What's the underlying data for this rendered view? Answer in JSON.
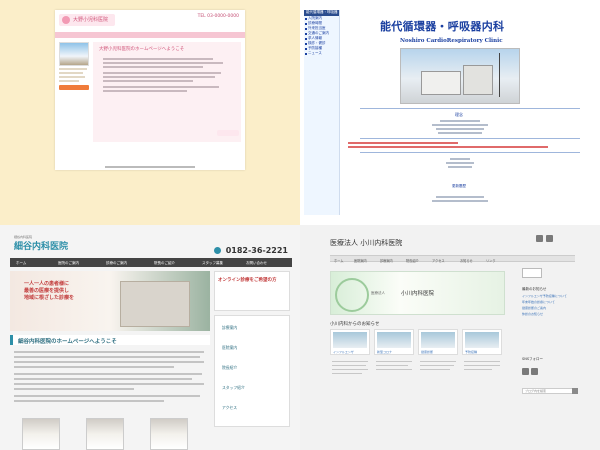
{
  "panel1": {
    "logo": "大野小児科医院",
    "tel": "TEL 03-0000-0000",
    "welcome": "大野小児科医院のホームページへようこそ"
  },
  "panel2": {
    "nav_top": "能代循環器・呼吸器",
    "nav_items": [
      "入院案内",
      "診療時間",
      "外来担当医",
      "交通のご案内",
      "求人情報",
      "検診・健診",
      "予防接種",
      "ニュース"
    ],
    "title": "能代循環器・呼吸器内科",
    "subtitle": "Noshiro CardioRespiratory Clinic",
    "rinen": "理念",
    "link": "更新履歴"
  },
  "panel3": {
    "logo_sub": "細谷内科医院",
    "logo": "細谷内科医院",
    "phone": "0182-36-2221",
    "nav": [
      "ホーム",
      "医院のご案内",
      "診療のご案内",
      "院長のご紹介",
      "スタッフ募集",
      "お問い合わせ"
    ],
    "hero_lines": [
      "一人一人の患者様に",
      "最善の医療を提供し",
      "地域に根ざした診療を"
    ],
    "welcome": "細谷内科医院のホームページへようこそ",
    "banner": "オンライン診療をご希望の方",
    "side_links": [
      "診療案内",
      "医院案内",
      "院長紹介",
      "スタッフ紹介",
      "アクセス"
    ]
  },
  "panel4": {
    "site_title": "医療法人 小川内科医院",
    "nav": [
      "ホーム",
      "医院案内",
      "診療案内",
      "院長紹介",
      "アクセス",
      "お知らせ",
      "リンク"
    ],
    "hero_label": "医療法人",
    "hero_name": "小川内科医院",
    "news_heading": "小川内科からのお知らせ",
    "cards": [
      "インフルエンザ",
      "新型コロナ",
      "健康診断",
      "予防接種"
    ],
    "aside_heading": "最新のお知らせ",
    "aside_links": [
      "インフルエンザ予防接種について",
      "年末年始の診療について",
      "健康診断のご案内",
      "休診のお知らせ"
    ],
    "aside_heading2": "SNSフォロー",
    "search_placeholder": "ブログ内を検索"
  }
}
